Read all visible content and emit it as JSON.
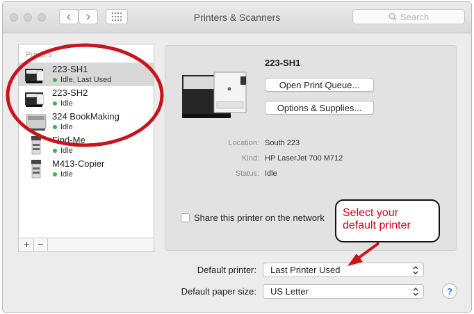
{
  "window": {
    "title": "Printers & Scanners"
  },
  "toolbar": {
    "back_glyph": "‹",
    "forward_glyph": "›",
    "search_placeholder": "Search"
  },
  "printers": {
    "header": "Printers",
    "items": [
      {
        "name": "223-SH1",
        "status": "Idle, Last Used",
        "selected": true
      },
      {
        "name": "223-SH2",
        "status": "Idle"
      },
      {
        "name": "324 BookMaking",
        "status": "Idle"
      },
      {
        "name": "Find-Me",
        "status": "Idle"
      },
      {
        "name": "M413-Copier",
        "status": "Idle"
      }
    ],
    "add_label": "+",
    "remove_label": "−"
  },
  "detail": {
    "name": "223-SH1",
    "open_queue_label": "Open Print Queue...",
    "options_label": "Options & Supplies...",
    "location_label": "Location:",
    "location_value": "South 223",
    "kind_label": "Kind:",
    "kind_value": "HP LaserJet 700 M712",
    "status_label": "Status:",
    "status_value": "Idle",
    "share_label": "Share this printer on the network",
    "share_checked": false
  },
  "annotation": {
    "line1": "Select your",
    "line2": "default printer",
    "color": "#d0021b"
  },
  "settings": {
    "default_printer_label": "Default printer:",
    "default_printer_value": "Last Printer Used",
    "paper_size_label": "Default paper size:",
    "paper_size_value": "US Letter",
    "help_label": "?"
  },
  "colors": {
    "status_dot": "#2fbd3b",
    "selection": "#d8d8d8",
    "annotation_red": "#d0021b"
  }
}
